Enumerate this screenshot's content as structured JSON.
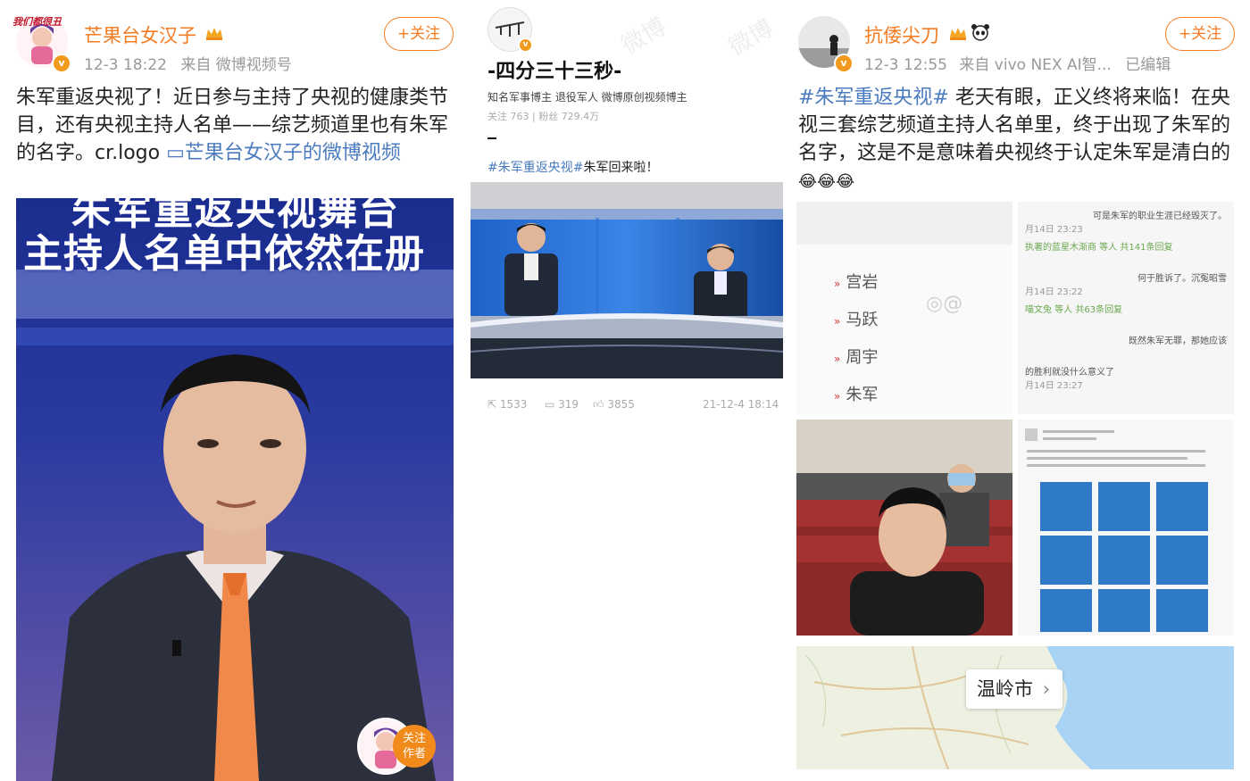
{
  "post1": {
    "username": "芒果台女汉子",
    "avatar_caption": "我们都很丑",
    "time": "12-3 18:22",
    "source_prefix": "来自",
    "source": "微博视频号",
    "follow_label": "+关注",
    "text_main": "朱军重返央视了！近日参与主持了央视的健康类节目，还有央视主持人名单——综艺频道里也有朱军的名字。cr.logo ",
    "text_link": "▭芒果台女汉子的微博视频",
    "image_caption_line1": "朱军重返央视舞台",
    "image_caption_line2": "主持人名单中依然在册",
    "follow_author_label1": "关注",
    "follow_author_label2": "作者"
  },
  "post2": {
    "name": "-四分三十三秒-",
    "desc": "知名军事博主  退役军人  微博原创视频博主",
    "stats": "关注 763  |  粉丝 729.4万",
    "hashtag": "#朱军重返央视#",
    "text": "朱军回来啦！",
    "reposts": "1533",
    "comments": "319",
    "likes": "3855",
    "date": "21-12-4 18:14",
    "watermark": "微博"
  },
  "post3": {
    "username": "抗倭尖刀",
    "time": "12-3 12:55",
    "source_prefix": "来自",
    "source": "vivo NEX AI智...",
    "edited": "已编辑",
    "follow_label": "+关注",
    "hashtag": "#朱军重返央视#",
    "text": " 老天有眼，正义终将来临！在央视三套综艺频道主持人名单里，终于出现了朱军的名字，这是不是意味着央视终于认定朱军是清白的",
    "emoji": "😂😂😂",
    "host_list": [
      "宫岩",
      "马跃",
      "周宇",
      "朱军"
    ],
    "chat_lines": [
      {
        "text": "可是朱军的职业生涯已经毁灭了。",
        "time": "月14日 23:23"
      },
      {
        "text": "执著的蓝星木渐商  等人 共141条回复",
        "time": ""
      },
      {
        "text": "何于胜诉了。沉冤昭雪",
        "time": "月14日 23:22"
      },
      {
        "text": "喵文兔 等人 共63条回复",
        "time": ""
      },
      {
        "text": "既然朱军无罪，那她应该",
        "time": ""
      },
      {
        "text": "的胜利就没什么意义了",
        "time": "月14日 23:27"
      }
    ],
    "map_place": "温岭市"
  }
}
